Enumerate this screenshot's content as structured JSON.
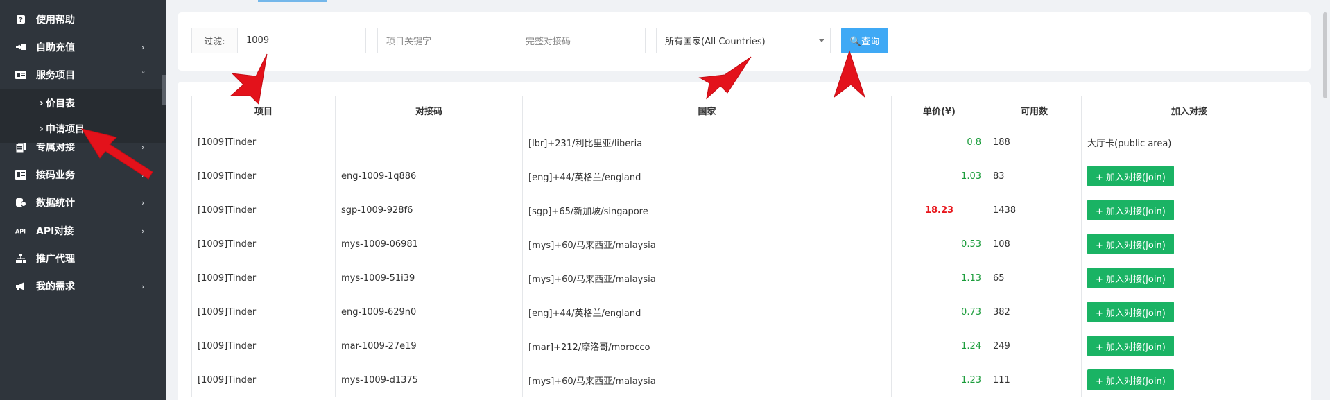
{
  "sidebar": {
    "items": [
      {
        "label": "使用帮助",
        "icon": "help-icon",
        "has_chevron": false
      },
      {
        "label": "自助充值",
        "icon": "recharge-icon",
        "has_chevron": true
      },
      {
        "label": "服务项目",
        "icon": "service-icon",
        "has_chevron": true,
        "expanded": true
      },
      {
        "label": "专属对接",
        "icon": "exclusive-icon",
        "has_chevron": true
      },
      {
        "label": "接码业务",
        "icon": "sms-icon",
        "has_chevron": true
      },
      {
        "label": "数据统计",
        "icon": "stats-icon",
        "has_chevron": true
      },
      {
        "label": "API对接",
        "icon": "api-icon",
        "has_chevron": true
      },
      {
        "label": "推广代理",
        "icon": "agent-icon",
        "has_chevron": false
      },
      {
        "label": "我的需求",
        "icon": "demand-icon",
        "has_chevron": true
      }
    ],
    "sub_items": [
      {
        "label": "价目表",
        "active": true
      },
      {
        "label": "申请项目",
        "active": false
      }
    ],
    "sub_caret": "›",
    "chevron_right": "›",
    "chevron_down": "˅"
  },
  "filter": {
    "label": "过滤:",
    "filter_value": "1009",
    "keyword_placeholder": "项目关键字",
    "code_placeholder": "完整对接码",
    "country_selected": "所有国家(All Countries)",
    "query_label": "🔍查询"
  },
  "table": {
    "headers": [
      "项目",
      "对接码",
      "国家",
      "单价(¥)",
      "可用数",
      "加入对接"
    ],
    "join_label": "+ 加入对接(Join)",
    "rows": [
      {
        "project": "[1009]Tinder",
        "code": "",
        "country": "[lbr]+231/利比里亚/liberia",
        "price": "0.8",
        "available": "188",
        "join": "大厅卡(public area)",
        "is_button": false,
        "hot": false
      },
      {
        "project": "[1009]Tinder",
        "code": "eng-1009-1q886",
        "country": "[eng]+44/英格兰/england",
        "price": "1.03",
        "available": "83",
        "is_button": true,
        "hot": false
      },
      {
        "project": "[1009]Tinder",
        "code": "sgp-1009-928f6",
        "country": "[sgp]+65/新加坡/singapore",
        "price": "18.23",
        "available": "1438",
        "is_button": true,
        "hot": true
      },
      {
        "project": "[1009]Tinder",
        "code": "mys-1009-06981",
        "country": "[mys]+60/马来西亚/malaysia",
        "price": "0.53",
        "available": "108",
        "is_button": true,
        "hot": false
      },
      {
        "project": "[1009]Tinder",
        "code": "mys-1009-51i39",
        "country": "[mys]+60/马来西亚/malaysia",
        "price": "1.13",
        "available": "65",
        "is_button": true,
        "hot": false
      },
      {
        "project": "[1009]Tinder",
        "code": "eng-1009-629n0",
        "country": "[eng]+44/英格兰/england",
        "price": "0.73",
        "available": "382",
        "is_button": true,
        "hot": false
      },
      {
        "project": "[1009]Tinder",
        "code": "mar-1009-27e19",
        "country": "[mar]+212/摩洛哥/morocco",
        "price": "1.24",
        "available": "249",
        "is_button": true,
        "hot": false
      },
      {
        "project": "[1009]Tinder",
        "code": "mys-1009-d1375",
        "country": "[mys]+60/马来西亚/malaysia",
        "price": "1.23",
        "available": "111",
        "is_button": true,
        "hot": false
      }
    ]
  },
  "colors": {
    "sidebar_bg": "#2f353c",
    "query_blue": "#3fa9f5",
    "join_green": "#1ab364",
    "price_green": "#1a9c3a",
    "price_red": "#e8161c",
    "annotation_red": "#e3121b"
  }
}
